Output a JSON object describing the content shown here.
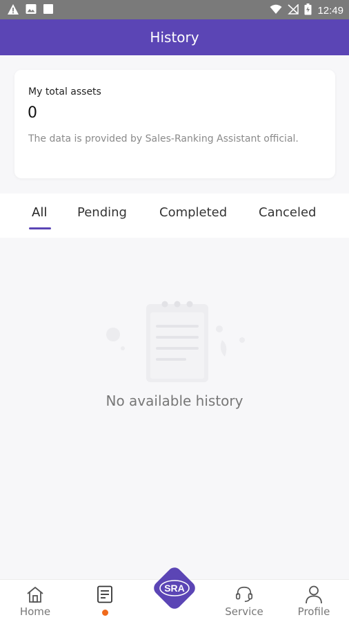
{
  "status_bar": {
    "time": "12:49",
    "left_icons": [
      "warning-icon",
      "image-icon",
      "square-icon"
    ],
    "right_icons": [
      "wifi-icon",
      "no-signal-icon",
      "battery-icon"
    ]
  },
  "header": {
    "title": "History"
  },
  "assets": {
    "label": "My total assets",
    "value": "0",
    "note": "The data is provided by Sales-Ranking Assistant official."
  },
  "tabs": {
    "items": [
      {
        "label": "All",
        "active": true
      },
      {
        "label": "Pending"
      },
      {
        "label": "Completed"
      },
      {
        "label": "Canceled"
      }
    ]
  },
  "empty_state": {
    "message": "No available history",
    "icon": "empty-clipboard-icon"
  },
  "bottom_nav": {
    "items": [
      {
        "label": "Home",
        "icon": "home-icon"
      },
      {
        "label": "",
        "icon": "document-icon",
        "badge": "dot"
      },
      {
        "label": "SRA",
        "icon": "sra-logo"
      },
      {
        "label": "Service",
        "icon": "headset-icon"
      },
      {
        "label": "Profile",
        "icon": "person-icon"
      }
    ]
  },
  "colors": {
    "primary": "#5b45b5",
    "badge": "#f06a1c",
    "status_bar": "#7a7a7a",
    "background": "#f7f7f9"
  }
}
